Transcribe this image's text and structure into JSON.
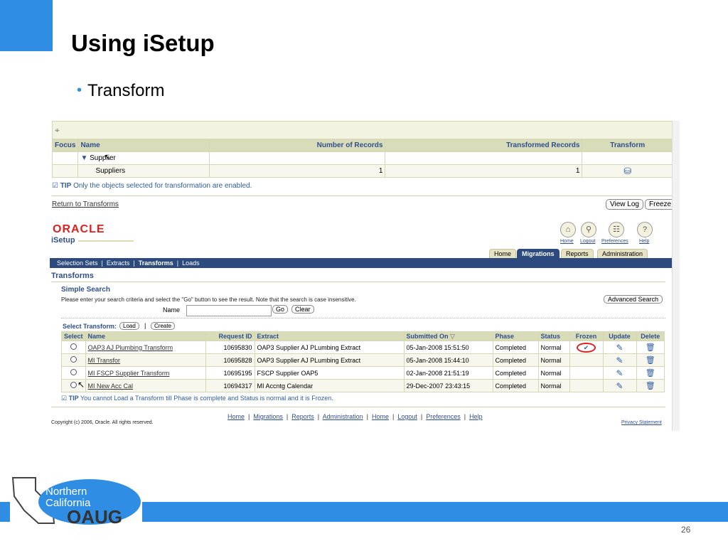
{
  "slide": {
    "title": "Using iSetup",
    "bullet": "Transform",
    "page_number": "26",
    "logo": {
      "line1": "Northern",
      "line2": "California",
      "line3": "OAUG"
    }
  },
  "transform_panel": {
    "columns": [
      "Focus",
      "Name",
      "Number of Records",
      "Transformed Records",
      "Transform"
    ],
    "rows": [
      {
        "name": "Supplier",
        "records": "",
        "transformed": ""
      },
      {
        "name": "Suppliers",
        "records": "1",
        "transformed": "1"
      }
    ],
    "tip_label": "TIP",
    "tip_text": "Only the objects selected for transformation are enabled.",
    "return_link": "Return to Transforms",
    "view_log": "View Log",
    "freeze": "Freeze"
  },
  "isetup": {
    "brand": "ORACLE",
    "product": "iSetup",
    "global_links": [
      "Home",
      "Logout",
      "Preferences",
      "Help"
    ],
    "tabs": [
      "Home",
      "Migrations",
      "Reports",
      "Administration"
    ],
    "active_tab": "Migrations",
    "subnav": [
      "Selection Sets",
      "Extracts",
      "Transforms",
      "Loads"
    ],
    "active_subnav": "Transforms",
    "page_title": "Transforms",
    "simple_search": {
      "title": "Simple Search",
      "description": "Please enter your search criteria and select the \"Go\" button to see the result. Note that the search is case insensitive.",
      "name_label": "Name",
      "go": "Go",
      "clear": "Clear",
      "advanced": "Advanced Search"
    },
    "select_transform": "Select Transform:",
    "load": "Load",
    "create": "Create",
    "table_headers": [
      "Select",
      "Name",
      "Request ID",
      "Extract",
      "Submitted On",
      "Phase",
      "Status",
      "Frozen",
      "Update",
      "Delete"
    ],
    "rows": [
      {
        "name": "OAP3 AJ Plumbing Transform",
        "request_id": "10695830",
        "extract": "OAP3 Supplier AJ PLumbing Extract",
        "submitted": "05-Jan-2008 15:51:50",
        "phase": "Completed",
        "status": "Normal",
        "frozen": true
      },
      {
        "name": "MI Transfor",
        "request_id": "10695828",
        "extract": "OAP3 Supplier AJ PLumbing Extract",
        "submitted": "05-Jan-2008 15:44:10",
        "phase": "Completed",
        "status": "Normal",
        "frozen": false
      },
      {
        "name": "MI FSCP Supplier Transform",
        "request_id": "10695195",
        "extract": "FSCP Supplier OAP5",
        "submitted": "02-Jan-2008 21:51:19",
        "phase": "Completed",
        "status": "Normal",
        "frozen": false
      },
      {
        "name": "MI New Acc Cal",
        "request_id": "10694317",
        "extract": "MI Accntg Calendar",
        "submitted": "29-Dec-2007 23:43:15",
        "phase": "Completed",
        "status": "Normal",
        "frozen": false
      }
    ],
    "tip_label": "TIP",
    "tip_text": "You cannot Load a Transform till Phase is complete and Status is normal and it is Frozen.",
    "footer_links": [
      "Home",
      "Migrations",
      "Reports",
      "Administration",
      "Home",
      "Logout",
      "Preferences",
      "Help"
    ],
    "copyright": "Copyright (c) 2006, Oracle. All rights reserved.",
    "privacy": "Privacy Statement"
  },
  "colors": {
    "accent": "#2f8de4",
    "oracle_nav": "#2c4a7e",
    "header_bg": "#d9dcb8",
    "frozen_circle": "#dd2222"
  }
}
